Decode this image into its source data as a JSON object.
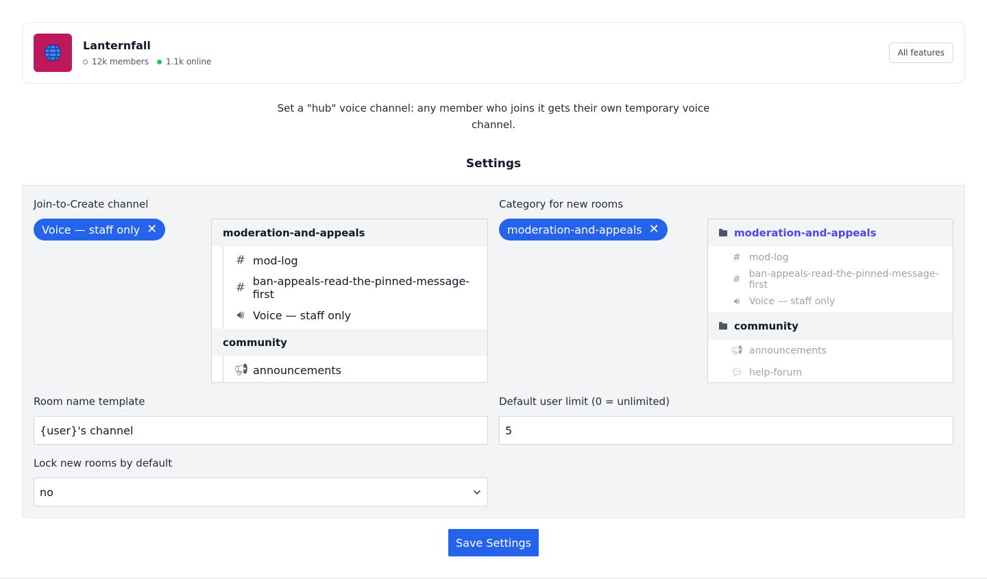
{
  "server": {
    "name": "Lanternfall",
    "members": "12k members",
    "online": "1.1k online",
    "icon": "globe-icon",
    "icon_bg": "#be185d",
    "all_features_label": "All features"
  },
  "intro": "Set a \"hub\" voice channel: any member who joins it gets their own temporary voice channel.",
  "settings_title": "Settings",
  "join_to_create": {
    "label": "Join-to-Create channel",
    "selected": "Voice — staff only",
    "tree": {
      "categories": [
        {
          "name": "moderation-and-appeals",
          "channels": [
            {
              "name": "mod-log",
              "icon": "hash-icon"
            },
            {
              "name": "ban-appeals-read-the-pinned-message-first",
              "icon": "hash-icon"
            },
            {
              "name": "Voice — staff only",
              "icon": "speaker-icon"
            }
          ]
        },
        {
          "name": "community",
          "channels": [
            {
              "name": "announcements",
              "icon": "megaphone-icon"
            }
          ]
        }
      ]
    }
  },
  "category": {
    "label": "Category for new rooms",
    "selected": "moderation-and-appeals",
    "tree": {
      "categories": [
        {
          "name": "moderation-and-appeals",
          "selected": true,
          "channels": [
            {
              "name": "mod-log",
              "icon": "hash-icon"
            },
            {
              "name": "ban-appeals-read-the-pinned-message-first",
              "icon": "hash-icon"
            },
            {
              "name": "Voice — staff only",
              "icon": "speaker-icon"
            }
          ]
        },
        {
          "name": "community",
          "channels": [
            {
              "name": "announcements",
              "icon": "megaphone-icon"
            },
            {
              "name": "help-forum",
              "icon": "forum-icon"
            }
          ]
        }
      ]
    }
  },
  "room_name_template": {
    "label": "Room name template",
    "value": "{user}'s channel"
  },
  "user_limit": {
    "label": "Default user limit (0 = unlimited)",
    "value": "5"
  },
  "lock_rooms": {
    "label": "Lock new rooms by default",
    "value": "no"
  },
  "save_label": "Save Settings",
  "colors": {
    "accent": "#2563eb",
    "selected_category": "#4f46e5",
    "online": "#22c55e"
  }
}
